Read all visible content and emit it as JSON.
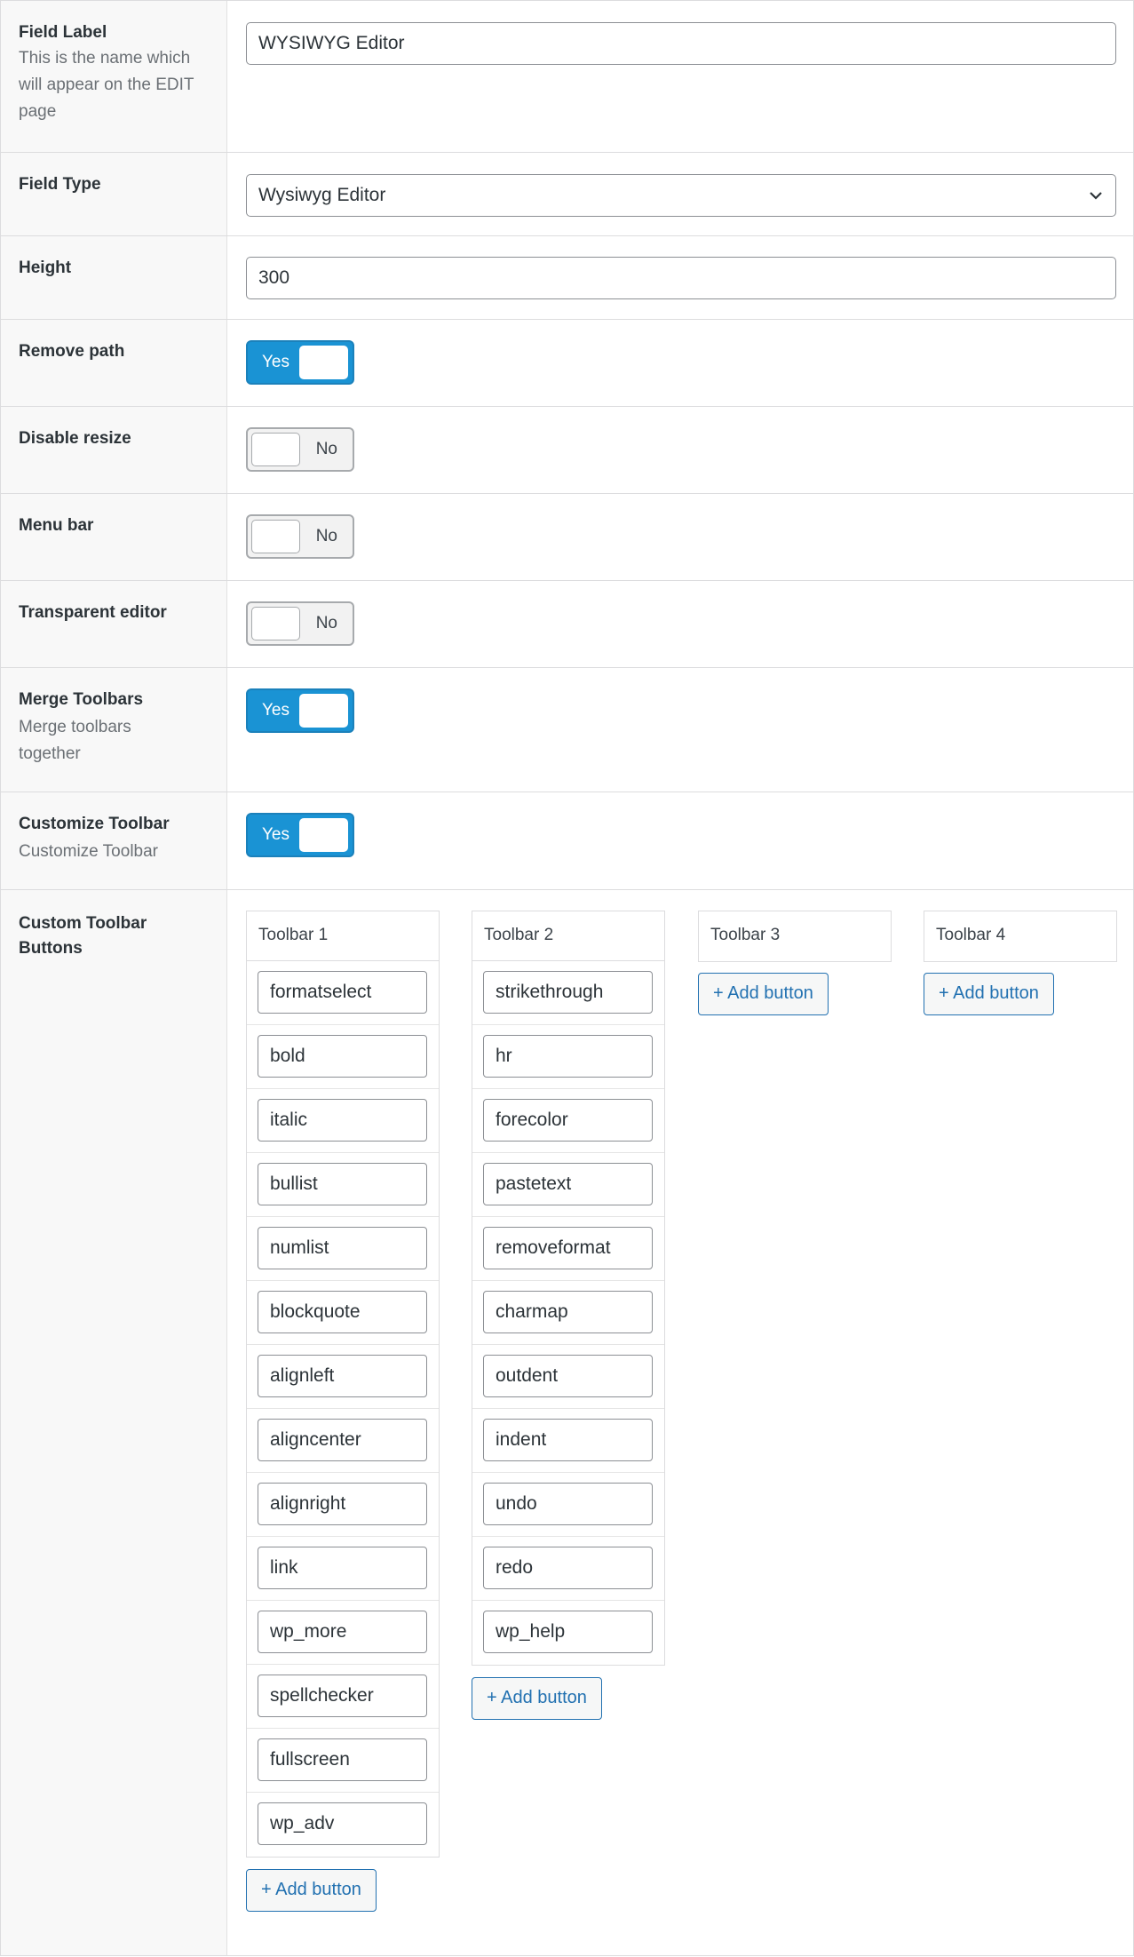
{
  "fields": {
    "field_label": {
      "title": "Field Label",
      "description_lines": [
        "This is the name which",
        "will appear on the EDIT",
        "page"
      ],
      "value": "WYSIWYG Editor"
    },
    "field_type": {
      "title": "Field Type",
      "value": "Wysiwyg Editor"
    },
    "height": {
      "title": "Height",
      "value": "300"
    },
    "remove_path": {
      "title": "Remove path",
      "toggle": "Yes"
    },
    "disable_resize": {
      "title": "Disable resize",
      "toggle": "No"
    },
    "menu_bar": {
      "title": "Menu bar",
      "toggle": "No"
    },
    "transparent_editor": {
      "title": "Transparent editor",
      "toggle": "No"
    },
    "merge_toolbars": {
      "title": "Merge Toolbars",
      "description_lines": [
        "Merge toolbars",
        "together"
      ],
      "toggle": "Yes"
    },
    "customize_toolbar": {
      "title": "Customize Toolbar",
      "description": "Customize Toolbar",
      "toggle": "Yes"
    },
    "custom_toolbar_buttons": {
      "title_lines": [
        "Custom Toolbar",
        "Buttons"
      ]
    }
  },
  "toolbars": [
    {
      "name": "Toolbar 1",
      "buttons": [
        "formatselect",
        "bold",
        "italic",
        "bullist",
        "numlist",
        "blockquote",
        "alignleft",
        "aligncenter",
        "alignright",
        "link",
        "wp_more",
        "spellchecker",
        "fullscreen",
        "wp_adv"
      ]
    },
    {
      "name": "Toolbar 2",
      "buttons": [
        "strikethrough",
        "hr",
        "forecolor",
        "pastetext",
        "removeformat",
        "charmap",
        "outdent",
        "indent",
        "undo",
        "redo",
        "wp_help"
      ]
    },
    {
      "name": "Toolbar 3",
      "buttons": []
    },
    {
      "name": "Toolbar 4",
      "buttons": []
    }
  ],
  "add_button_label": "+ Add button",
  "icons": {
    "select_caret": "chevron-down-icon"
  },
  "colors": {
    "toggle_on": "#1a93d4",
    "link_blue": "#2271b1"
  }
}
